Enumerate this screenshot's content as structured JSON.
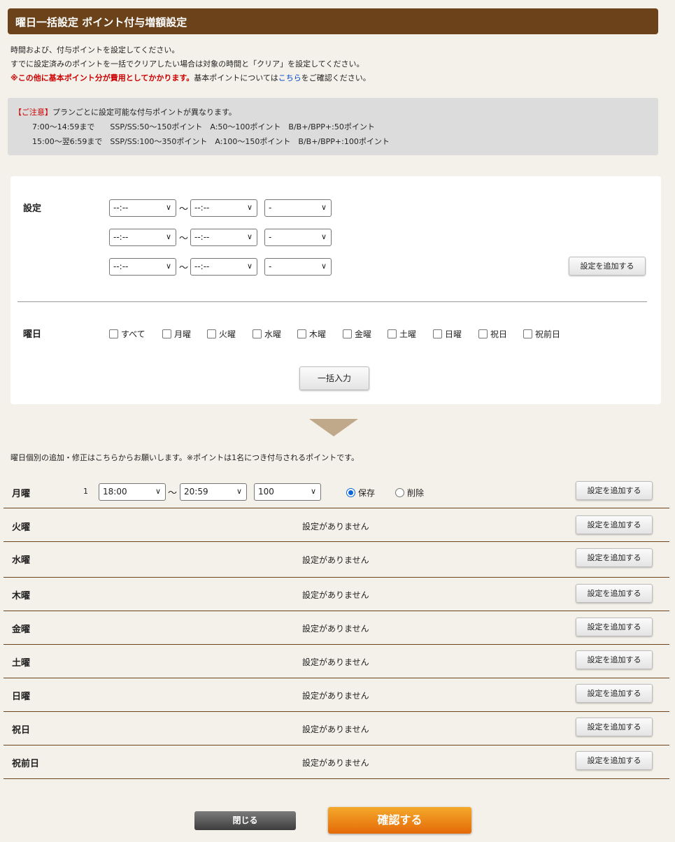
{
  "header": {
    "title": "曜日一括設定 ポイント付与増額設定"
  },
  "intro": {
    "line1": "時間および、付与ポイントを設定してください。",
    "line2": "すでに設定済みのポイントを一括でクリアしたい場合は対象の時間と「クリア」を設定してください。",
    "line3_red": "※この他に基本ポイント分が費用としてかかります。",
    "line3_a": "基本ポイントについては",
    "line3_link": "こちら",
    "line3_b": "をご確認ください。"
  },
  "notice": {
    "caution": "【ご注意】",
    "line1": "プランごとに設定可能な付与ポイントが異なります。",
    "line2": "7:00〜14:59まで　　SSP/SS:50〜150ポイント　A:50〜100ポイント　B/B+/BPP+:50ポイント",
    "line3": "15:00〜翌6:59まで　SSP/SS:100〜350ポイント　A:100〜150ポイント　B/B+/BPP+:100ポイント"
  },
  "bulk": {
    "setting_label": "設定",
    "time_placeholder": "--:--",
    "tilde": "〜",
    "points_placeholder": "-",
    "add_button": "設定を追加する",
    "weekday_label": "曜日",
    "checkboxes": [
      "すべて",
      "月曜",
      "火曜",
      "水曜",
      "木曜",
      "金曜",
      "土曜",
      "日曜",
      "祝日",
      "祝前日"
    ],
    "apply_button": "一括入力"
  },
  "individual": {
    "note": "曜日個別の追加・修正はこちらからお願いします。※ポイントは1名につき付与されるポイントです。",
    "empty_text": "設定がありません",
    "add_button": "設定を追加する",
    "monday": {
      "day": "月曜",
      "index": "1",
      "start": "18:00",
      "end": "20:59",
      "points": "100",
      "save_label": "保存",
      "delete_label": "削除",
      "selected": "保存"
    },
    "days": [
      "火曜",
      "水曜",
      "木曜",
      "金曜",
      "土曜",
      "日曜",
      "祝日",
      "祝前日"
    ]
  },
  "footer": {
    "close_button": "閉じる",
    "confirm_button": "確認する"
  },
  "colors": {
    "title_bar": "#6b4219",
    "accent_red": "#cc0000",
    "confirm": "#ee8a18",
    "radio": "#0a66d6"
  }
}
